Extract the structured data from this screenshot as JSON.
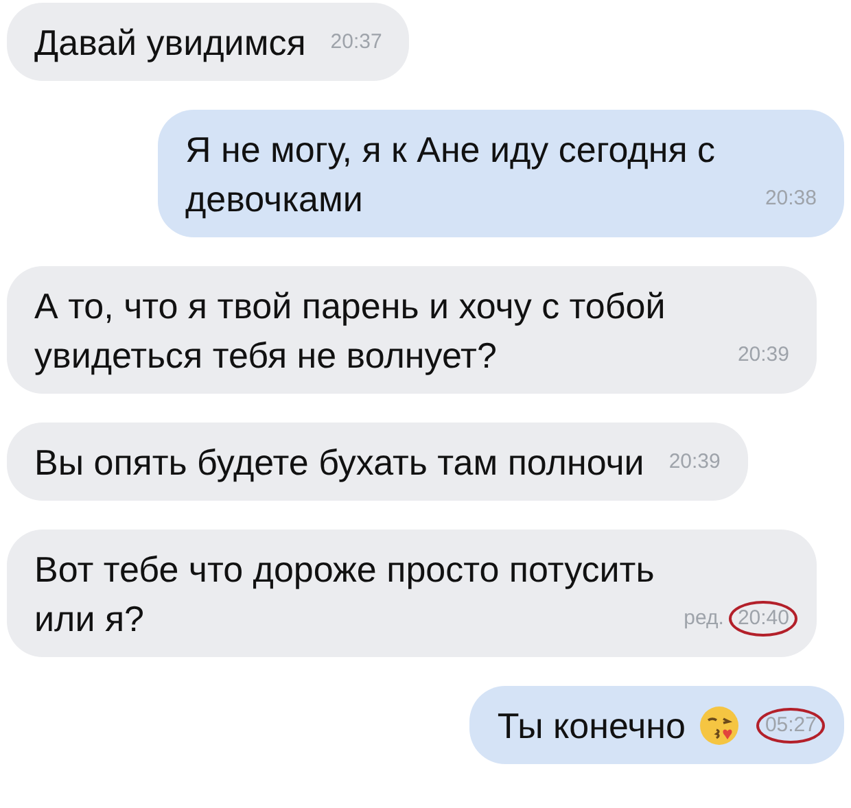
{
  "messages": [
    {
      "kind": "incoming",
      "text": "Давай увидимся",
      "time": "20:37",
      "circled": false
    },
    {
      "kind": "outgoing",
      "text": "Я не могу, я к Ане иду сегодня с девочками",
      "time": "20:38",
      "circled": false
    },
    {
      "kind": "incoming",
      "text": "А то, что я твой парень и хочу с тобой увидеться тебя не волнует?",
      "time": "20:39",
      "circled": false
    },
    {
      "kind": "incoming",
      "text": "Вы опять будете бухать там полночи",
      "time": "20:39",
      "circled": false
    },
    {
      "kind": "incoming",
      "text": "Вот тебе что дороже просто потусить или я?",
      "edited": "ред.",
      "time": "20:40",
      "circled": true
    },
    {
      "kind": "outgoing",
      "text": "Ты конечно",
      "emoji": true,
      "time": "05:27",
      "circled": true
    }
  ]
}
